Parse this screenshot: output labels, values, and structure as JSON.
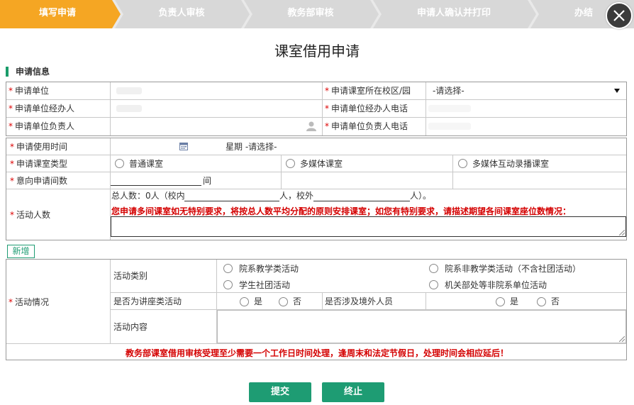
{
  "steps": [
    {
      "label": "填写申请",
      "active": true
    },
    {
      "label": "负责人审核",
      "active": false
    },
    {
      "label": "教务部审核",
      "active": false
    },
    {
      "label": "申请人确认并打印",
      "active": false
    },
    {
      "label": "办结",
      "active": false
    }
  ],
  "colors": {
    "active_step": "#f5a623",
    "inactive_step": "#d8d8d8",
    "accent": "#1e9c73",
    "notice": "#d40000"
  },
  "page_title": "课室借用申请",
  "section_title": "申请信息",
  "form": {
    "unit_label": "申请单位",
    "campus_label": "申请课室所在校区/园",
    "campus_value": "-请选择-",
    "handler_label": "申请单位经办人",
    "handler_phone_label": "申请单位经办人电话",
    "leader_label": "申请单位负责人",
    "leader_phone_label": "申请单位负责人电话",
    "time_label": "申请使用时间",
    "weekday_text": "星期 -请选择-",
    "room_type_label": "申请课室类型",
    "room_types": [
      "普通课室",
      "多媒体课室",
      "多媒体互动录播课室"
    ],
    "count_label": "意向申请间数",
    "count_unit": "间",
    "people_label": "活动人数",
    "people_total_prefix": "总人数：0人（校内",
    "people_mid": "人，校外",
    "people_suffix": "人）。",
    "people_notice": "您申请多间课室如无特别要求，将按总人数平均分配的原则安排课室；如您有特别要求，请描述期望各间课室座位数情况：",
    "add_label": "新增",
    "activity_label": "活动情况",
    "activity_type_label": "活动类别",
    "activity_types": [
      "院系教学类活动",
      "院系非教学类活动（不含社团活动）",
      "学生社团活动",
      "机关部处等非院系单位活动"
    ],
    "lecture_label": "是否为讲座类活动",
    "foreign_label": "是否涉及境外人员",
    "yes": "是",
    "no": "否",
    "content_label": "活动内容",
    "bottom_notice": "教务部课室借用审核受理至少需要一个工作日时间处理，逢周末和法定节假日，处理时间会相应延后！"
  },
  "buttons": {
    "submit": "提交",
    "stop": "终止"
  },
  "icons": [
    "close-icon",
    "calendar-icon",
    "person-icon",
    "chevron-down-icon"
  ]
}
